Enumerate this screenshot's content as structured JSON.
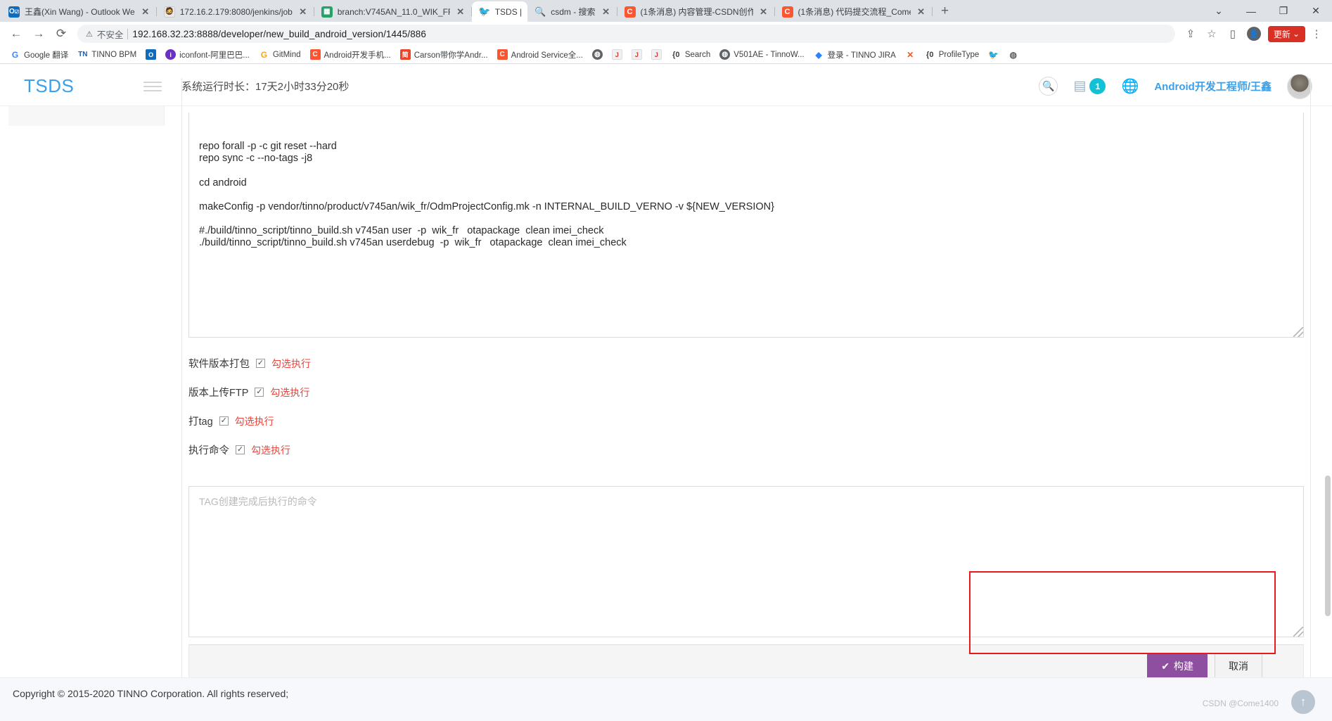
{
  "browser": {
    "tabs": [
      {
        "title": "王鑫(Xin Wang) - Outlook We",
        "favicon": "outlook-icon",
        "active": false
      },
      {
        "title": "172.16.2.179:8080/jenkins/job",
        "favicon": "jenkins-icon",
        "active": false
      },
      {
        "title": "branch:V745AN_11.0_WIK_FR",
        "favicon": "git-icon",
        "active": false
      },
      {
        "title": "TSDS |",
        "favicon": "twitter-icon",
        "active": true
      },
      {
        "title": "csdm - 搜索",
        "favicon": "search-icon",
        "active": false
      },
      {
        "title": "(1条消息) 内容管理-CSDN创作",
        "favicon": "csdn-icon",
        "active": false
      },
      {
        "title": "(1条消息) 代码提交流程_Come",
        "favicon": "csdn-icon",
        "active": false
      }
    ],
    "new_tab_label": "+",
    "window_controls": {
      "minimize": "—",
      "maximize": "❐",
      "close": "✕",
      "list": "⌄"
    },
    "nav": {
      "back": "←",
      "forward": "→",
      "reload": "⟳"
    },
    "omnibox": {
      "security_icon": "warning-triangle-icon",
      "security_label": "不安全",
      "url": "192.168.32.23:8888/developer/new_build_android_version/1445/886"
    },
    "toolbar_right": {
      "share_icon": "share-icon",
      "star_icon": "star-icon",
      "sidepanel_icon": "side-panel-icon",
      "profile_icon": "profile-icon",
      "update_label": "更新",
      "menu_icon": "kebab-menu-icon"
    },
    "bookmarks": [
      {
        "label": "Google 翻译",
        "icon": "google-translate-icon",
        "cls": "ic-gt",
        "glyph": "G"
      },
      {
        "label": "TINNO BPM",
        "icon": "tinno-bpm-icon",
        "cls": "ic-tn",
        "glyph": "TN"
      },
      {
        "label": "",
        "icon": "outlook-icon",
        "cls": "ic-ol",
        "glyph": "O"
      },
      {
        "label": "iconfont-阿里巴巴...",
        "icon": "iconfont-icon",
        "cls": "ic-if",
        "glyph": "i"
      },
      {
        "label": "GitMind",
        "icon": "gitmind-icon",
        "cls": "ic-gm",
        "glyph": "G"
      },
      {
        "label": "Android开发手机...",
        "icon": "csdn-icon",
        "cls": "ic-csdn",
        "glyph": "C"
      },
      {
        "label": "Carson带你学Andr...",
        "icon": "jianshu-icon",
        "cls": "ic-jj",
        "glyph": "简"
      },
      {
        "label": "Android Service全...",
        "icon": "csdn-icon",
        "cls": "ic-csdn",
        "glyph": "C"
      },
      {
        "label": "",
        "icon": "globe-icon",
        "cls": "ic-glb",
        "glyph": "◍"
      },
      {
        "label": "",
        "icon": "jenkins-icon",
        "cls": "ic-jk",
        "glyph": "J"
      },
      {
        "label": "",
        "icon": "jenkins-icon",
        "cls": "ic-jk",
        "glyph": "J"
      },
      {
        "label": "",
        "icon": "jenkins-icon",
        "cls": "ic-jk",
        "glyph": "J"
      },
      {
        "label": "Search",
        "icon": "sourcegraph-icon",
        "cls": "ic-s0",
        "glyph": "{0"
      },
      {
        "label": "V501AE - TinnoW...",
        "icon": "globe-icon",
        "cls": "ic-glb",
        "glyph": "◍"
      },
      {
        "label": "登录 - TINNO JIRA",
        "icon": "jira-icon",
        "cls": "ic-jira",
        "glyph": "◆"
      },
      {
        "label": "",
        "icon": "x-icon",
        "cls": "ic-x",
        "glyph": "✕"
      },
      {
        "label": "ProfileType",
        "icon": "sourcegraph-icon",
        "cls": "ic-s0",
        "glyph": "{0"
      },
      {
        "label": "",
        "icon": "twitter-icon",
        "cls": "ic-tw",
        "glyph": "🐦"
      },
      {
        "label": "",
        "icon": "globe-icon",
        "cls": "ic-bl",
        "glyph": "◍"
      }
    ]
  },
  "app": {
    "brand": "TSDS",
    "menu_icon": "hamburger-menu-icon",
    "uptime": "系统运行时长：17天2小时33分20秒",
    "header_icons": {
      "search": "search-icon",
      "calendar": "calendar-icon",
      "badge_count": "1",
      "globe": "globe-icon"
    },
    "username": "Android开发工程师/王鑫",
    "avatar": "user-avatar"
  },
  "build_form": {
    "script_value": "repo forall -p -c git reset --hard\nrepo sync -c --no-tags -j8\n\ncd android\n\nmakeConfig -p vendor/tinno/product/v745an/wik_fr/OdmProjectConfig.mk -n INTERNAL_BUILD_VERNO -v ${NEW_VERSION}\n\n#./build/tinno_script/tinno_build.sh v745an user  -p  wik_fr   otapackage  clean imei_check\n./build/tinno_script/tinno_build.sh v745an userdebug  -p  wik_fr   otapackage  clean imei_check",
    "options": [
      {
        "label": "软件版本打包",
        "checked": true,
        "hint": "勾选执行"
      },
      {
        "label": "版本上传FTP",
        "checked": true,
        "hint": "勾选执行"
      },
      {
        "label": "打tag",
        "checked": true,
        "hint": "勾选执行"
      },
      {
        "label": "执行命令",
        "checked": true,
        "hint": "勾选执行"
      }
    ],
    "command_placeholder": "TAG创建完成后执行的命令",
    "command_value": "",
    "build_button": "构建",
    "build_button_icon": "check-icon",
    "cancel_button": "取消"
  },
  "footer": {
    "copyright": "Copyright © 2015-2020 TINNO Corporation. All rights reserved;",
    "watermark": "CSDN @Come1400",
    "back_to_top_icon": "arrow-up-icon"
  }
}
